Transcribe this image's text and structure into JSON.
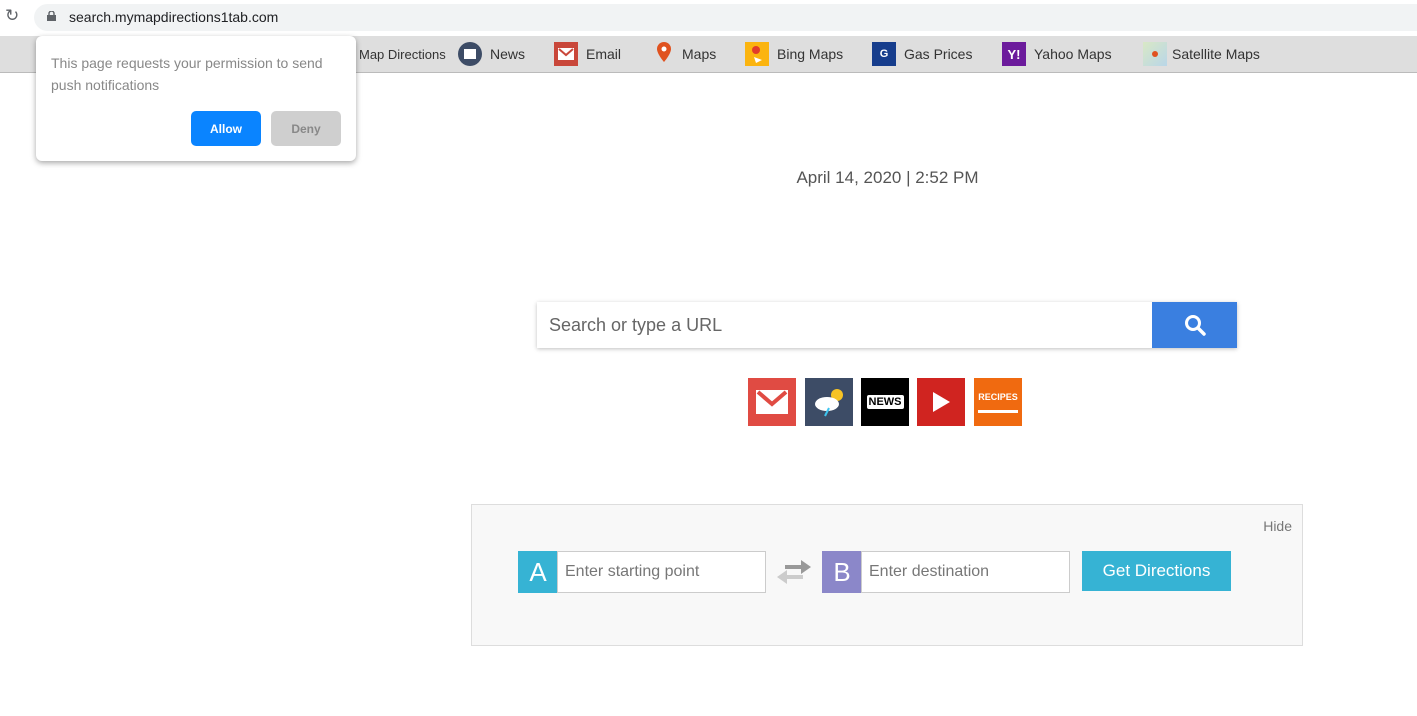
{
  "browser": {
    "url": "search.mymapdirections1tab.com"
  },
  "toolbar": {
    "items": [
      {
        "label": "Map Directions",
        "icon": "none"
      },
      {
        "label": "News",
        "icon": "newspaper-icon"
      },
      {
        "label": "Email",
        "icon": "email-icon"
      },
      {
        "label": "Maps",
        "icon": "map-pin-icon"
      },
      {
        "label": "Bing Maps",
        "icon": "bing-maps-icon"
      },
      {
        "label": "Gas Prices",
        "icon": "gas-prices-icon"
      },
      {
        "label": "Yahoo Maps",
        "icon": "yahoo-icon"
      },
      {
        "label": "Satellite Maps",
        "icon": "satellite-map-icon"
      }
    ],
    "gas_icon_text": "G",
    "yahoo_icon_text": "Y!"
  },
  "popup": {
    "message": "This page requests your permission to send push notifications",
    "allow": "Allow",
    "deny": "Deny"
  },
  "datetime": "April 14, 2020 | 2:52 PM",
  "search": {
    "placeholder": "Search or type a URL"
  },
  "quicklinks": {
    "news": "NEWS",
    "recipes": "RECIPES"
  },
  "directions": {
    "hide": "Hide",
    "a": "A",
    "b": "B",
    "start_placeholder": "Enter starting point",
    "dest_placeholder": "Enter destination",
    "button": "Get Directions"
  },
  "colors": {
    "accent": "#3a7fe0",
    "allow": "#0a84ff",
    "directions": "#36b3d4",
    "b_label": "#8b87c9"
  }
}
